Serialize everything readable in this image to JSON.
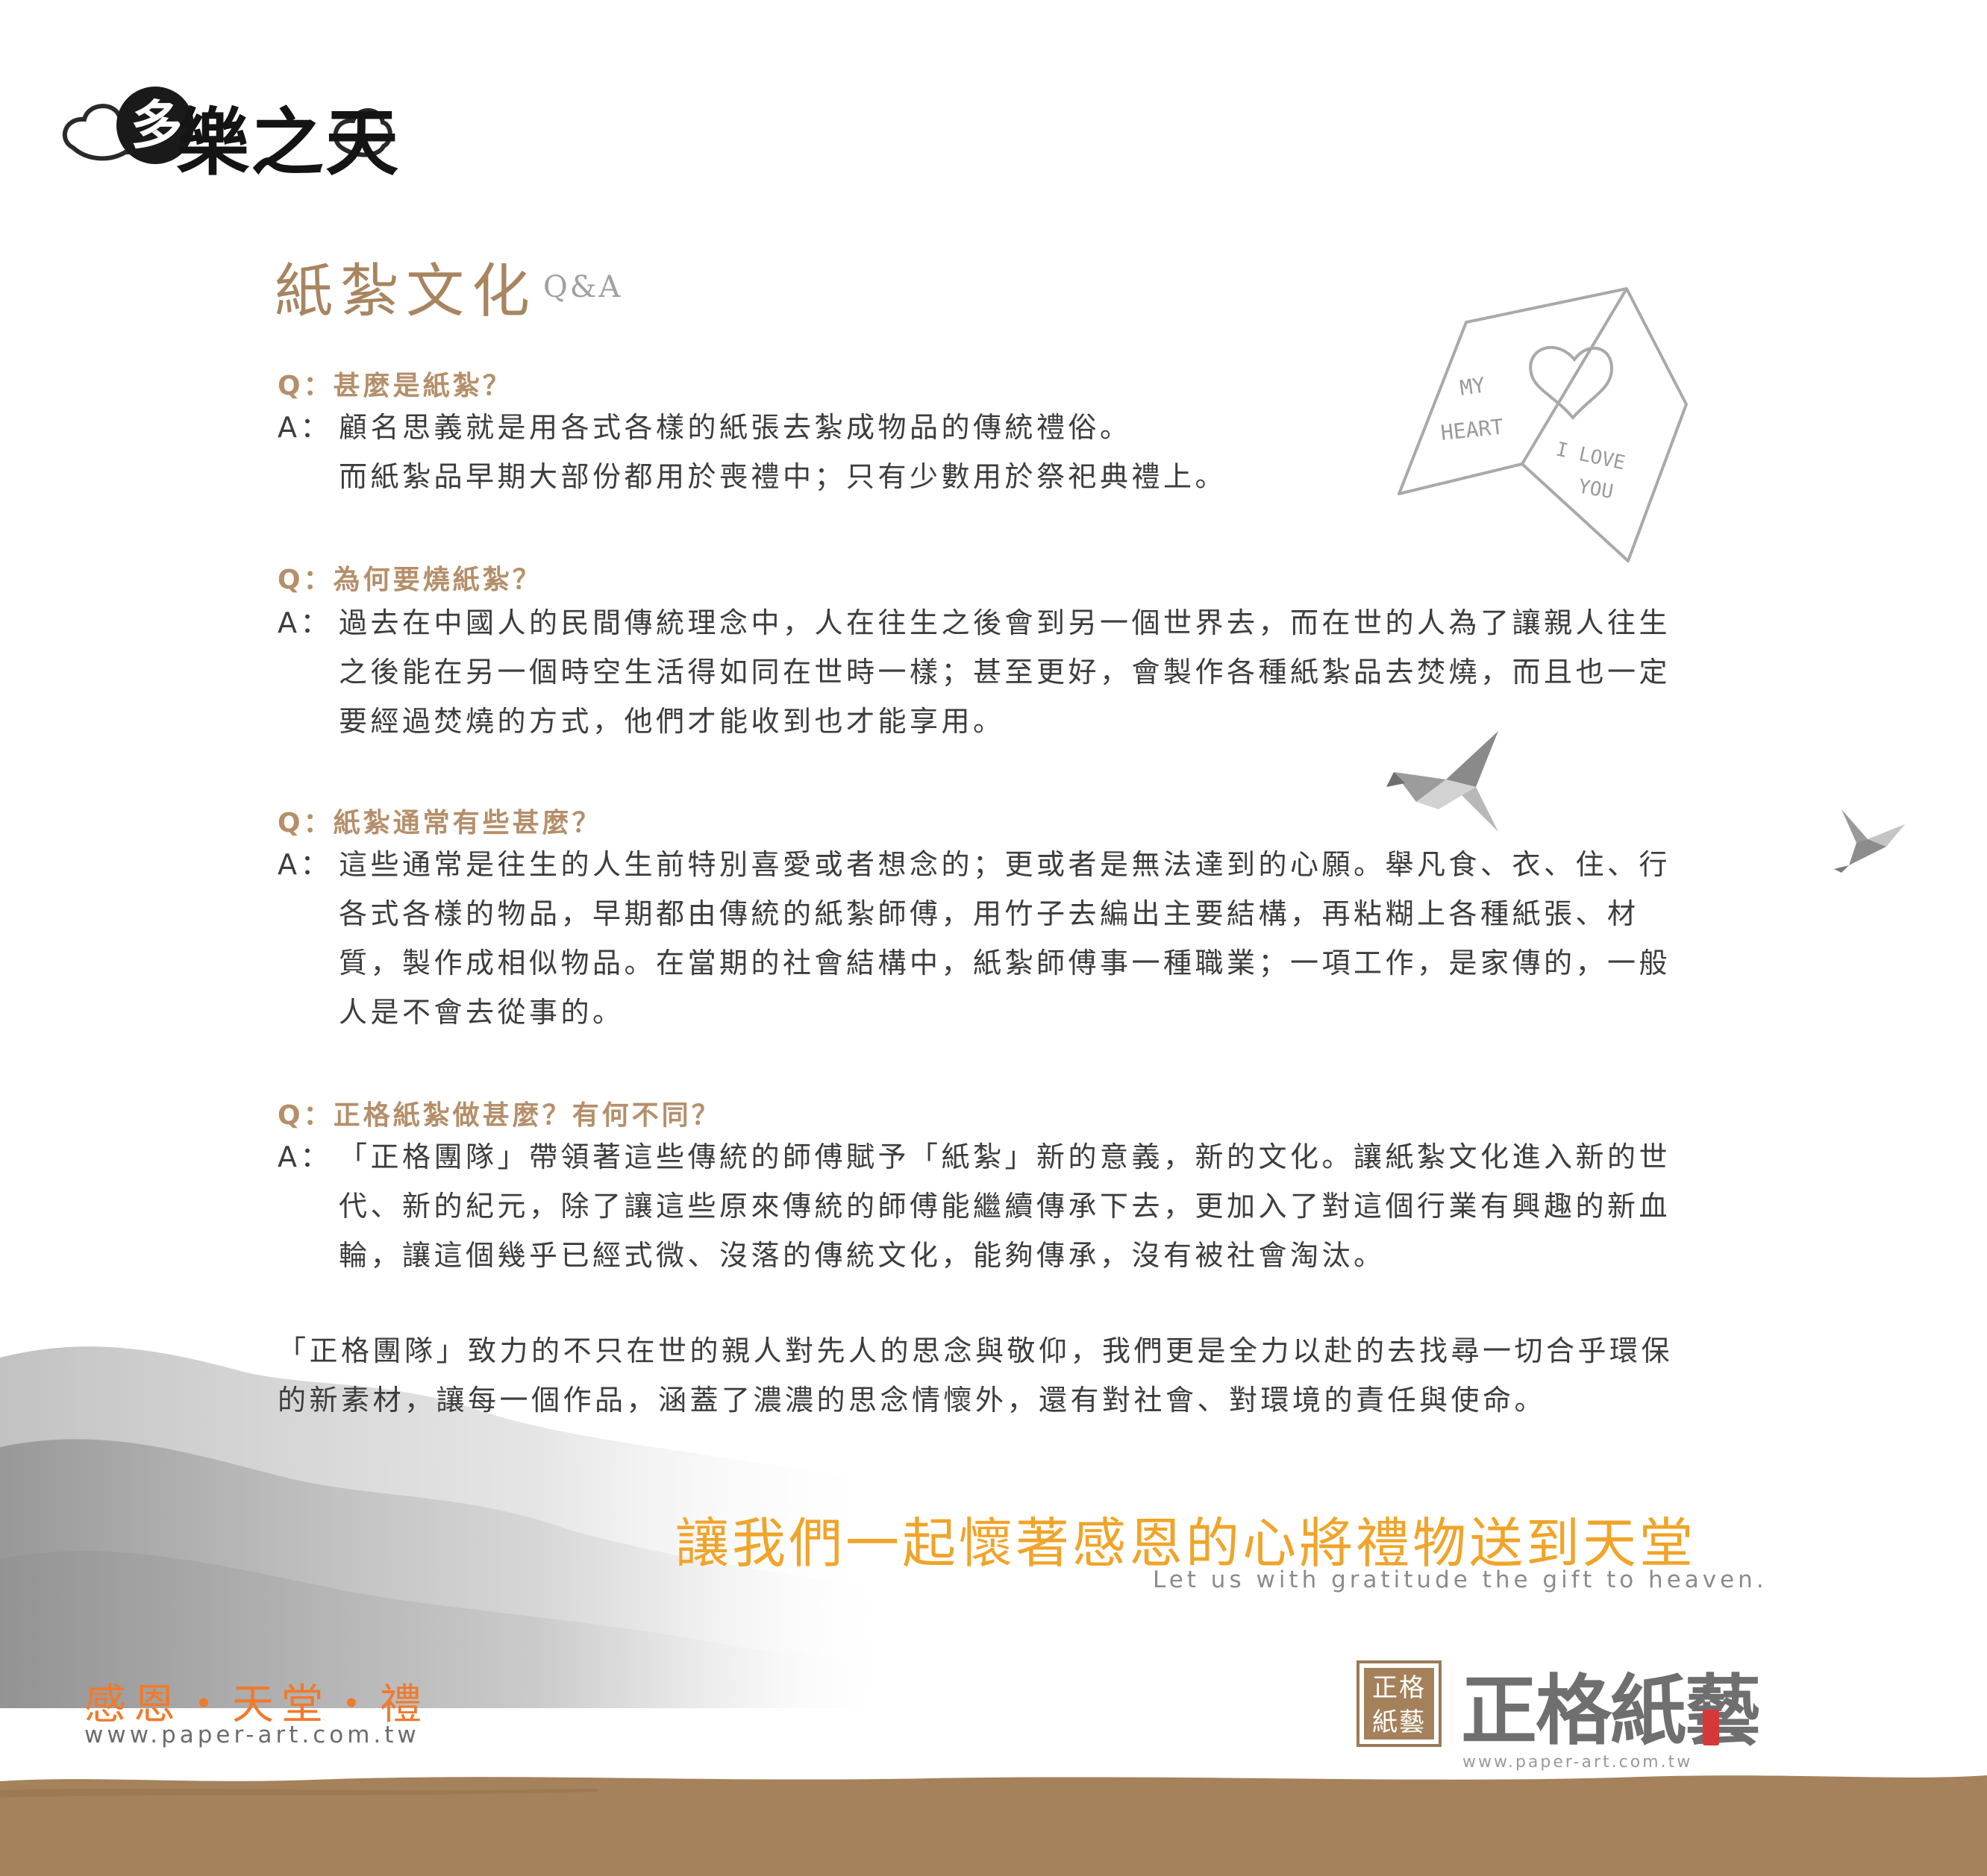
{
  "header": {
    "logo_disc_char": "多",
    "logo_text": "樂之天"
  },
  "title": {
    "main": "紙紮文化",
    "suffix": "Q&A"
  },
  "qa": [
    {
      "q": "Q：甚麼是紙紮？",
      "a_mark": "A：",
      "a": "顧名思義就是用各式各樣的紙張去紮成物品的傳統禮俗。\n而紙紮品早期大部份都用於喪禮中；只有少數用於祭祀典禮上。"
    },
    {
      "q": "Q：為何要燒紙紮？",
      "a_mark": "A：",
      "a": "過去在中國人的民間傳統理念中，人在往生之後會到另一個世界去，而在世的人為了讓親人往生\n之後能在另一個時空生活得如同在世時一樣；甚至更好，會製作各種紙紮品去焚燒，而且也一定\n要經過焚燒的方式，他們才能收到也才能享用。"
    },
    {
      "q": "Q：紙紮通常有些甚麼？",
      "a_mark": "A：",
      "a": "這些通常是往生的人生前特別喜愛或者想念的；更或者是無法達到的心願。舉凡食、衣、住、行\n各式各樣的物品，早期都由傳統的紙紮師傅，用竹子去編出主要結構，再粘糊上各種紙張、材\n質，製作成相似物品。在當期的社會結構中，紙紮師傅事一種職業；一項工作，是家傳的，一般\n人是不會去從事的。"
    },
    {
      "q": "Q：正格紙紮做甚麼？有何不同？",
      "a_mark": "A：",
      "a": "「正格團隊」帶領著這些傳統的師傅賦予「紙紮」新的意義，新的文化。讓紙紮文化進入新的世\n代、新的紀元，除了讓這些原來傳統的師傅能繼續傳承下去，更加入了對這個行業有興趣的新血\n輪，讓這個幾乎已經式微、沒落的傳統文化，能夠傳承，沒有被社會淘汰。"
    }
  ],
  "closing": "「正格團隊」致力的不只在世的親人對先人的思念與敬仰，我們更是全力以赴的去找尋一切合乎環保\n的新素材，讓每一個作品，涵蓋了濃濃的思念情懷外，還有對社會、對環境的責任與使命。",
  "slogan": {
    "cn": "讓我們一起懷著感恩的心將禮物送到天堂",
    "en": "Let us with gratitude the gift to heaven."
  },
  "heart_card": {
    "left_text_1": "MY",
    "left_text_2": "HEART",
    "right_text_1": "I LOVE",
    "right_text_2": "YOU"
  },
  "footer": {
    "tagline": "感恩・天堂・禮",
    "url": "www.paper-art.com.tw",
    "brand_box_line1": "正格",
    "brand_box_line2": "紙藝",
    "brand_name": "正格紙藝",
    "brand_url": "www.paper-art.com.tw"
  },
  "colors": {
    "title": "#a88560",
    "question": "#b58f6a",
    "slogan": "#f0a429",
    "tagline": "#f07a2c",
    "band": "#a5825c"
  }
}
